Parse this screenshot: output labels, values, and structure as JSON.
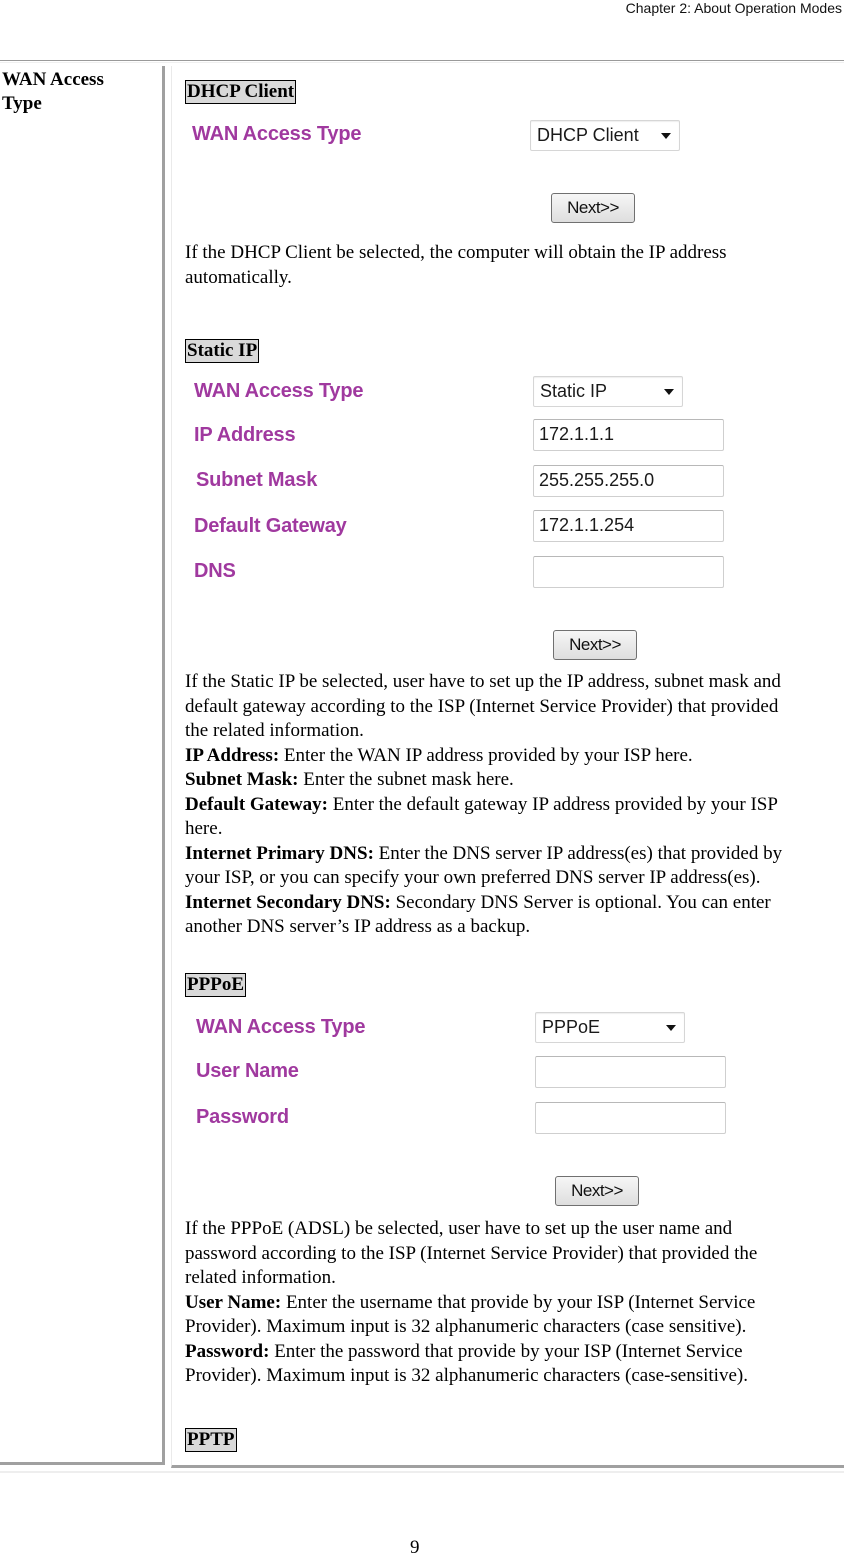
{
  "header": {
    "chapter": "Chapter 2: About Operation Modes"
  },
  "table": {
    "left_title_line1": "WAN Access",
    "left_title_line2": "Type"
  },
  "sections": {
    "dhcp": {
      "tag": "DHCP Client",
      "form": {
        "wan_label": "WAN Access Type",
        "wan_selected": "DHCP Client",
        "next_label": "Next>>"
      },
      "desc_line1": "If the DHCP Client be selected, the computer will obtain the IP address",
      "desc_line2": "automatically."
    },
    "static": {
      "tag": "Static IP",
      "form": {
        "wan_label": "WAN Access Type",
        "wan_selected": "Static IP",
        "ip_label": "IP Address",
        "ip_value": "172.1.1.1",
        "mask_label": "Subnet Mask",
        "mask_value": "255.255.255.0",
        "gateway_label": "Default Gateway",
        "gateway_value": "172.1.1.254",
        "dns_label": "DNS",
        "dns_value": "",
        "next_label": "Next>>"
      },
      "desc_lines": [
        "If the Static IP be selected, user have to set up the IP address, subnet mask and",
        "default gateway according to the ISP (Internet Service Provider) that provided",
        "the related information."
      ],
      "fields": [
        {
          "term": "IP Address:",
          "text": " Enter the WAN IP address provided by your ISP here."
        },
        {
          "term": "Subnet Mask:",
          "text": " Enter the subnet mask here."
        },
        {
          "term": "Default Gateway:",
          "text": " Enter the default gateway IP address provided by your ISP",
          "cont": "here."
        },
        {
          "term": "Internet Primary DNS:",
          "text": " Enter the DNS server IP address(es) that provided by",
          "cont": "your ISP, or you can specify your own preferred DNS server IP address(es)."
        },
        {
          "term": "Internet Secondary DNS:",
          "text": " Secondary DNS Server is optional. You can enter",
          "cont": "another DNS server’s IP address as a backup."
        }
      ]
    },
    "pppoe": {
      "tag": "PPPoE",
      "form": {
        "wan_label": "WAN Access Type",
        "wan_selected": "PPPoE",
        "user_label": "User Name",
        "user_value": "",
        "pass_label": "Password",
        "pass_value": "",
        "next_label": "Next>>"
      },
      "desc_lines": [
        "If the PPPoE (ADSL) be selected, user have to set up the user name and",
        "password according to the ISP (Internet Service Provider) that provided the",
        "related information."
      ],
      "fields": [
        {
          "term": "User Name:",
          "text": " Enter the username that provide by your ISP (Internet Service",
          "cont": "Provider). Maximum input is 32 alphanumeric characters (case sensitive)."
        },
        {
          "term": "Password:",
          "text": " Enter the password that provide by your ISP (Internet Service",
          "cont": "Provider). Maximum input is 32 alphanumeric characters (case-sensitive)."
        }
      ]
    },
    "pptp": {
      "tag": "PPTP"
    }
  },
  "footer": {
    "page_number": "9"
  },
  "colors": {
    "form_label": "#a0399f",
    "tag_bg": "#d9d9d9",
    "rule": "#a0a0a0"
  }
}
